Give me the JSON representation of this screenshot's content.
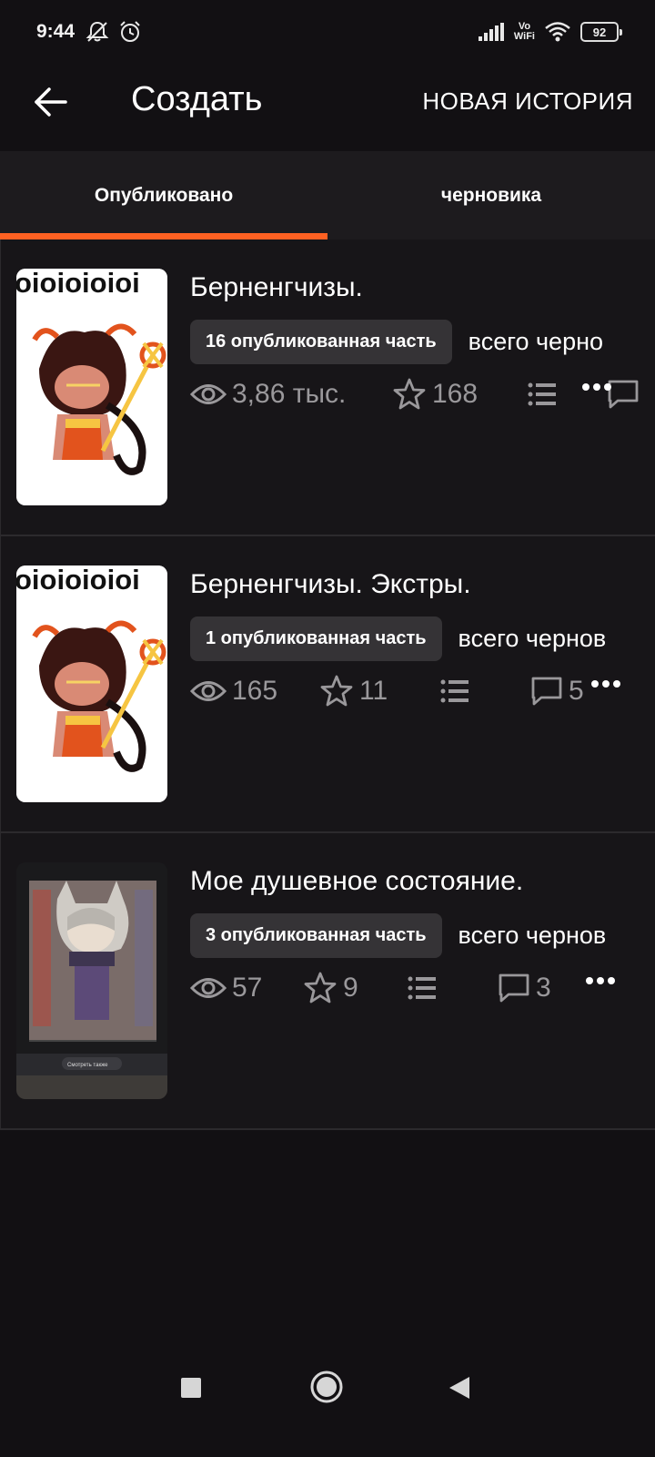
{
  "status_bar": {
    "time": "9:44",
    "volte_top": "Vo",
    "volte_bottom": "WiFi",
    "battery": "92"
  },
  "header": {
    "title": "Создать",
    "new_story_label": "НОВАЯ ИСТОРИЯ"
  },
  "tabs": [
    {
      "label": "Опубликовано",
      "active": true
    },
    {
      "label": "черновика",
      "active": false
    }
  ],
  "stories": [
    {
      "title": "Берненгчизы.",
      "published_badge": "16 опубликованная часть",
      "drafts_text": "всего черно",
      "views": "3,86 тыс.",
      "votes": "168",
      "comments": ""
    },
    {
      "title": "Берненгчизы. Экстры.",
      "published_badge": "1 опубликованная часть",
      "drafts_text": "всего чернов",
      "views": "165",
      "votes": "11",
      "comments": "5"
    },
    {
      "title": "Мое душевное состояние.",
      "published_badge": "3 опубликованная часть",
      "drafts_text": "всего чернов",
      "views": "57",
      "votes": "9",
      "comments": "3"
    }
  ],
  "cover_text": {
    "binary_strip": "oioioioioi",
    "screen_label": "Смотреть также"
  },
  "colors": {
    "background": "#121013",
    "accent": "#ff6122",
    "badge": "#353336",
    "muted": "#9a989b"
  }
}
